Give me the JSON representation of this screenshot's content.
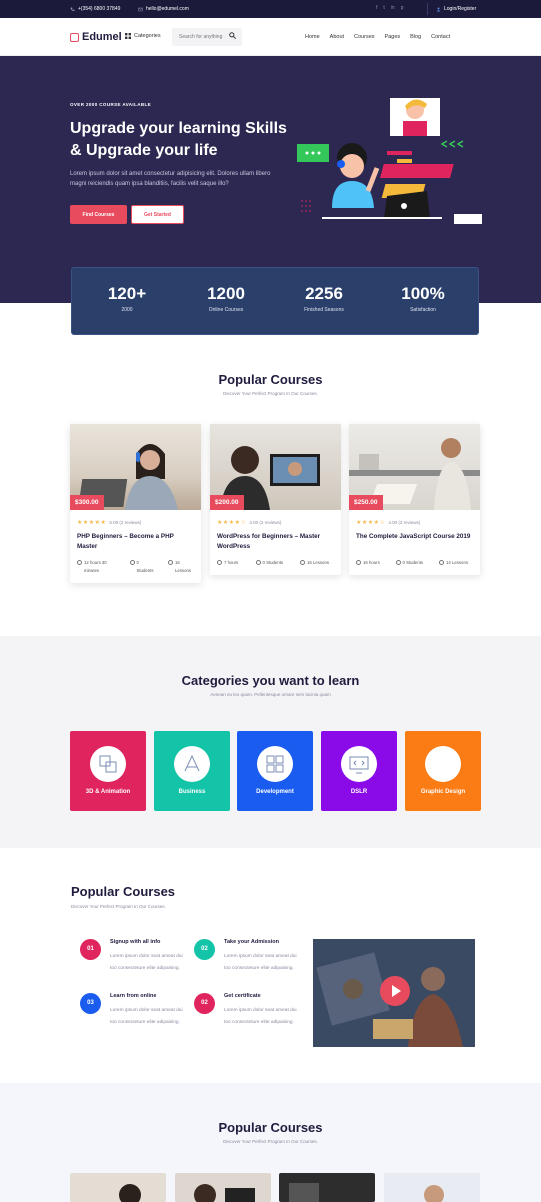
{
  "topbar": {
    "phone": "+(354) 6800 37849",
    "email": "hello@edumel.com",
    "socials": [
      "f",
      "t",
      "in",
      "p"
    ],
    "login": "Login/Register"
  },
  "nav": {
    "logo": "Edumel",
    "categories": "Categories",
    "search_placeholder": "Search for anything",
    "menu": [
      "Home",
      "About",
      "Courses",
      "Pages",
      "Blog",
      "Contact"
    ]
  },
  "hero": {
    "kicker": "OVER 2000 COURSE AVAILABLE",
    "title": "Upgrade your learning Skills & Upgrade your life",
    "description": "Lorem ipsum dolor sit amet consectetur adipisicing elit. Dolores ullam libero magni reiciendis quam ipsa blanditiis, facilis velit saque illo?",
    "btn_primary": "Find Courses",
    "btn_secondary": "Get Started"
  },
  "stats": [
    {
      "num": "120+",
      "label": "2000"
    },
    {
      "num": "1200",
      "label": "Online Courses"
    },
    {
      "num": "2256",
      "label": "Finished Seasons"
    },
    {
      "num": "100%",
      "label": "Satisfaction"
    }
  ],
  "popular": {
    "title": "Popular Courses",
    "subtitle": "Discover Your Perfect Program In Our Courses.",
    "courses": [
      {
        "price": "$300.00",
        "stars": "★★★★★",
        "rating": "5.00 (2 reviews)",
        "title": "PHP Beginners – Become a PHP Master",
        "hours": "12 hours 30 minutes",
        "students": "0 Students",
        "lessons": "16 Lessons"
      },
      {
        "price": "$200.00",
        "stars": "★★★★☆",
        "rating": "4.00 (2 reviews)",
        "title": "WordPress for Beginners – Master WordPress",
        "hours": "7 hours",
        "students": "0 Students",
        "lessons": "15 Lessons"
      },
      {
        "price": "$250.00",
        "stars": "★★★★☆",
        "rating": "4.00 (2 reviews)",
        "title": "The Complete JavaScript Course 2019",
        "hours": "16 hours",
        "students": "0 Students",
        "lessons": "14 Lessons"
      }
    ]
  },
  "categories": {
    "title": "Categories you want to learn",
    "subtitle": "Aenean eu leo quam. Pellentesque ornare sem lacinia quam",
    "items": [
      {
        "name": "3D & Animation",
        "color": "#e0245e"
      },
      {
        "name": "Business",
        "color": "#14c4a8"
      },
      {
        "name": "Development",
        "color": "#1a5cf0"
      },
      {
        "name": "DSLR",
        "color": "#8a0be8"
      },
      {
        "name": "Graphic Design",
        "color": "#fb7b14"
      }
    ]
  },
  "steps": {
    "title": "Popular Courses",
    "subtitle": "Discover Your Perfect Program In Our Courses.",
    "items": [
      {
        "num": "01",
        "title": "Signup with all info",
        "text": "Lorem ipsum dolor seat ameat dui too consecteture elite adipaising.",
        "color": "#e0245e"
      },
      {
        "num": "02",
        "title": "Take your Admission",
        "text": "Lorem ipsum dolor seat ameat dui too consecteture elite adipaising.",
        "color": "#14c4a8"
      },
      {
        "num": "03",
        "title": "Learn from online",
        "text": "Lorem ipsum dolor seat ameat dui too consecteture elite adipaising.",
        "color": "#1a5cf0"
      },
      {
        "num": "02",
        "title": "Get certificate",
        "text": "Lorem ipsum dolor seat ameat dui too consecteture elite adipaising.",
        "color": "#e0245e"
      }
    ]
  },
  "bottom": {
    "title": "Popular Courses",
    "subtitle": "Discover Your Perfect Program In Our Courses."
  },
  "colors": {
    "accent": "#e84b5e",
    "hero_bg": "#2c2851",
    "topbar_bg": "#1c1a3b",
    "stats_bg": "#2b3f6b"
  }
}
